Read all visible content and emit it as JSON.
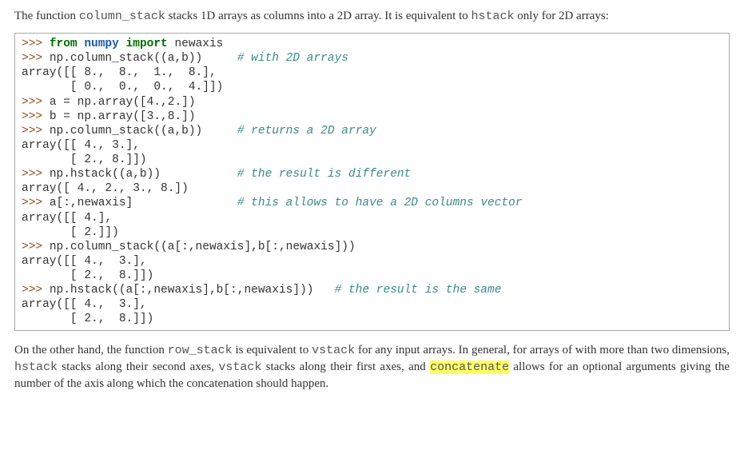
{
  "intro": {
    "pre": "The function ",
    "fn": "column_stack",
    "mid": " stacks 1D arrays as columns into a 2D array. It is equivalent to ",
    "fn2": "hstack",
    "post": " only for 2D arrays:"
  },
  "code": {
    "l01_prompt": ">>> ",
    "l01_from": "from",
    "l01_sp1": " ",
    "l01_mod": "numpy",
    "l01_sp2": " ",
    "l01_import": "import",
    "l01_rest": " newaxis",
    "l02_prompt": ">>> ",
    "l02_code": "np.column_stack((a,b))     ",
    "l02_comment": "# with 2D arrays",
    "l03": "array([[ 8.,  8.,  1.,  8.],",
    "l04": "       [ 0.,  0.,  0.,  4.]])",
    "l05_prompt": ">>> ",
    "l05_code": "a = np.array([4.,2.])",
    "l06_prompt": ">>> ",
    "l06_code": "b = np.array([3.,8.])",
    "l07_prompt": ">>> ",
    "l07_code": "np.column_stack((a,b))     ",
    "l07_comment": "# returns a 2D array",
    "l08": "array([[ 4., 3.],",
    "l09": "       [ 2., 8.]])",
    "l10_prompt": ">>> ",
    "l10_code": "np.hstack((a,b))           ",
    "l10_comment": "# the result is different",
    "l11": "array([ 4., 2., 3., 8.])",
    "l12_prompt": ">>> ",
    "l12_code": "a[:,newaxis]               ",
    "l12_comment": "# this allows to have a 2D columns vector",
    "l13": "array([[ 4.],",
    "l14": "       [ 2.]])",
    "l15_prompt": ">>> ",
    "l15_code": "np.column_stack((a[:,newaxis],b[:,newaxis]))",
    "l16": "array([[ 4.,  3.],",
    "l17": "       [ 2.,  8.]])",
    "l18_prompt": ">>> ",
    "l18_code": "np.hstack((a[:,newaxis],b[:,newaxis]))   ",
    "l18_comment": "# the result is the same",
    "l19": "array([[ 4.,  3.],",
    "l20": "       [ 2.,  8.]])"
  },
  "outro": {
    "t1": "On the other hand, the function ",
    "fn1": "row_stack",
    "t2": " is equivalent to ",
    "fn2": "vstack",
    "t3": " for any input arrays. In general, for arrays of with more than two dimensions, ",
    "fn3": "hstack",
    "t4": " stacks along their second axes, ",
    "fn4": "vstack",
    "t5": " stacks along their first axes, and ",
    "fn5": "concatenate",
    "t6": " allows for an optional arguments giving the number of the axis along which the concatenation should happen."
  }
}
